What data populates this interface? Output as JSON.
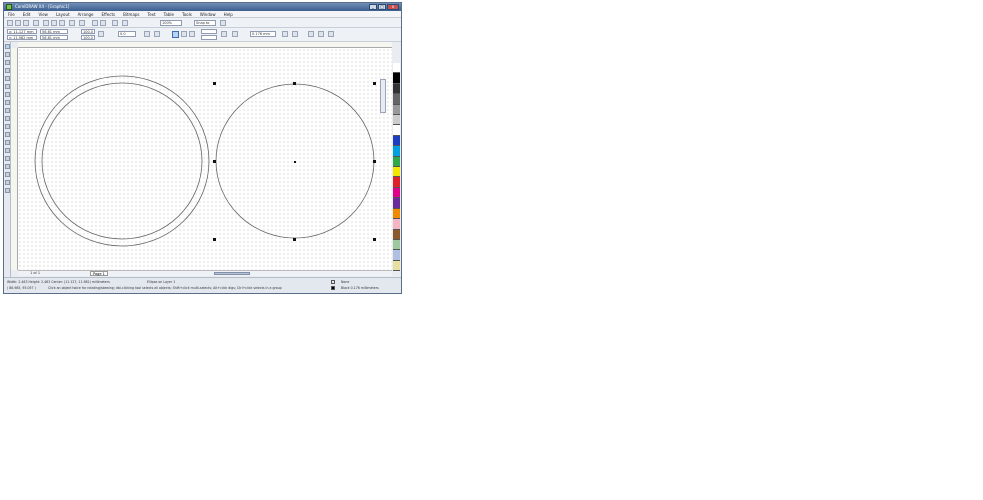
{
  "window": {
    "title": "CorelDRAW X4 - [Graphic1]",
    "controls": {
      "minimize": "_",
      "maximize": "□",
      "close": "x"
    }
  },
  "menu": [
    "File",
    "Edit",
    "View",
    "Layout",
    "Arrange",
    "Effects",
    "Bitmaps",
    "Text",
    "Table",
    "Tools",
    "Window",
    "Help"
  ],
  "toolbar": {
    "zoom": "100%",
    "snap": "Snap to"
  },
  "property_bar": {
    "x": "x: 11.127 mm",
    "y": "y: 11.982 mm",
    "width": "56.61 mm",
    "height": "56.61 mm",
    "scale_w": "100.0",
    "scale_h": "100.0",
    "angle": "0.0",
    "outline": "0.176 mm"
  },
  "page_nav": {
    "counter": "1 of 1",
    "page_tab": "Page 1"
  },
  "status": {
    "dimensions": "Width: 2.463  Height: 2.463  Center: (11.127, 11.982)  millimeters",
    "layer": "Ellipse on Layer 1",
    "coords": "( 86.985, 95.057 )",
    "hint": "Click an object twice for rotating/skewing; dbl-clicking tool selects all objects; Shift+click multi-selects; Alt+click digs; Ctrl+click selects in a group",
    "fill": "None",
    "outline": "Black  0.176 millimeters"
  },
  "colors": {
    "title_bar": "#3d5f8e",
    "selection_handle": "#111111"
  }
}
